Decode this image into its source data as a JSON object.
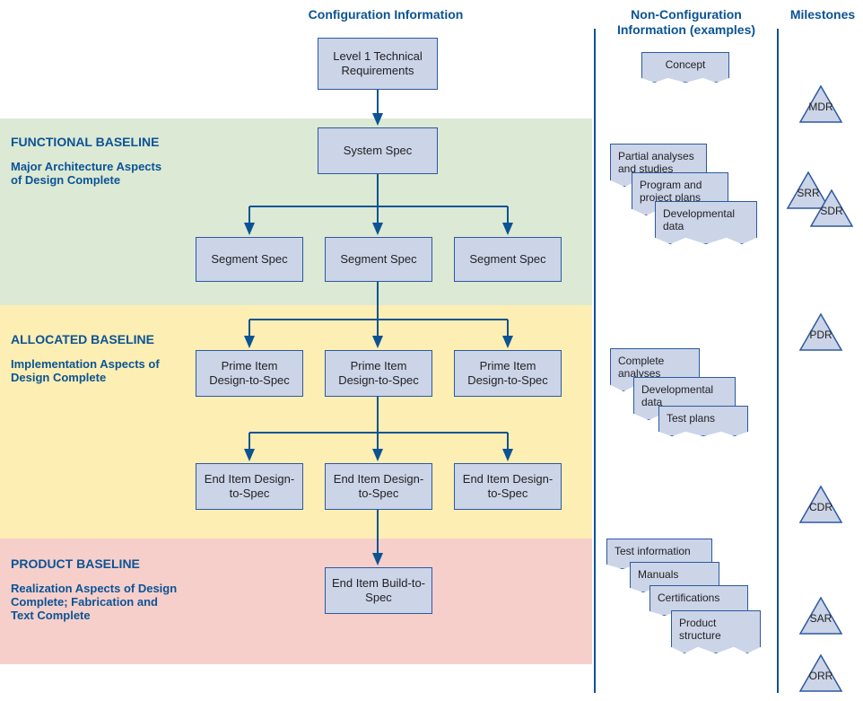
{
  "headers": {
    "config": "Configuration Information",
    "nonconfig": "Non-Configuration Information (examples)",
    "milestones": "Milestones"
  },
  "bands": {
    "functional": {
      "title": "FUNCTIONAL BASELINE",
      "sub": "Major Architecture Aspects of Design Complete"
    },
    "allocated": {
      "title": "ALLOCATED BASELINE",
      "sub": "Implementation Aspects of Design Complete"
    },
    "product": {
      "title": "PRODUCT BASELINE",
      "sub": "Realization Aspects of Design Complete; Fabrication and Text Complete"
    }
  },
  "nodes": {
    "level1": "Level 1 Technical Requirements",
    "system_spec": "System Spec",
    "segment_spec": "Segment Spec",
    "prime_item": "Prime Item Design-to-Spec",
    "end_item_design": "End Item Design-to-Spec",
    "end_item_build": "End Item Build-to-Spec"
  },
  "docs": {
    "concept": "Concept",
    "partial": "Partial analyses and studies",
    "program_plans": "Program and project plans",
    "dev_data1": "Developmental data",
    "complete": "Complete analyses",
    "dev_data2": "Developmental data",
    "test_plans": "Test plans",
    "test_info": "Test information",
    "manuals": "Manuals",
    "certs": "Certifications",
    "product_struct": "Product structure"
  },
  "milestones": {
    "mdr": "MDR",
    "srr": "SRR",
    "sdr": "SDR",
    "pdr": "PDR",
    "cdr": "CDR",
    "sar": "SAR",
    "orr": "ORR"
  }
}
